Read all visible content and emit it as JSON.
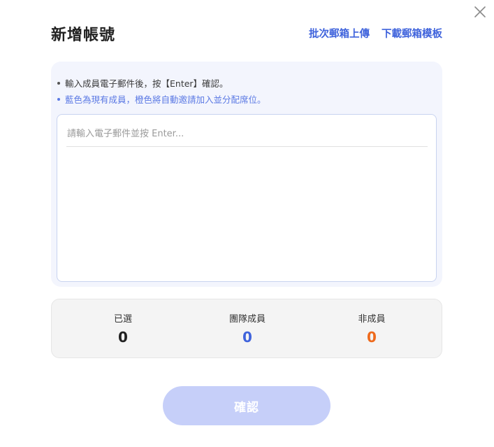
{
  "dialog": {
    "title": "新增帳號",
    "close_icon": "close-icon"
  },
  "header_links": {
    "batch_upload": "批次郵箱上傳",
    "download_template": "下載郵箱模板"
  },
  "hints": {
    "line1": "輸入成員電子郵件後，按【Enter】確認。",
    "line2": "藍色為現有成員，橙色將自動邀請加入並分配席位。"
  },
  "email_input": {
    "placeholder": "請輸入電子郵件並按 Enter...",
    "value": ""
  },
  "stats": {
    "selected_label": "已選",
    "selected_value": "0",
    "members_label": "團隊成員",
    "members_value": "0",
    "non_members_label": "非成員",
    "non_members_value": "0"
  },
  "colors": {
    "accent_blue": "#3f63dc",
    "non_member_orange": "#ee6a1c",
    "hint_blue": "#5b79e4",
    "confirm_disabled": "#c6cff9"
  },
  "confirm_button": {
    "label": "確認"
  }
}
